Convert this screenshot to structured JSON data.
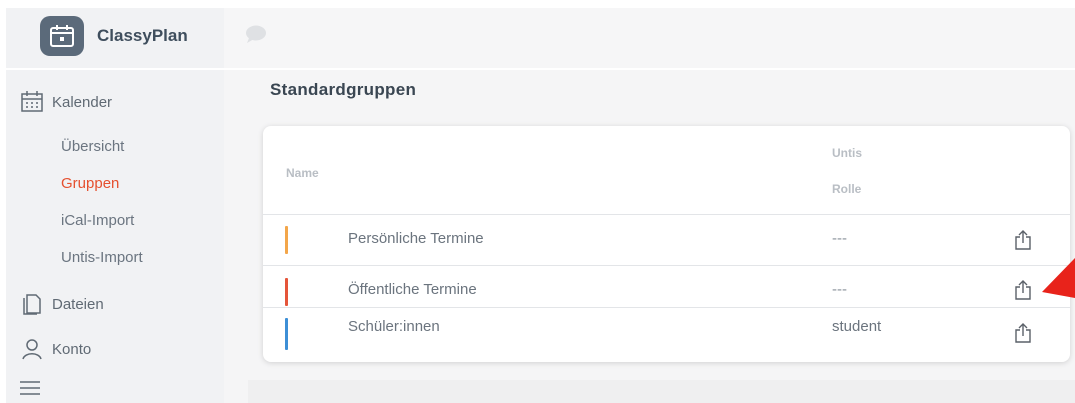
{
  "header": {
    "brand": "ClassyPlan",
    "logo_icon": "calendar-icon",
    "chat_icon": "speech-bubble-icon"
  },
  "sidebar": {
    "calendar_label": "Kalender",
    "sub_items": [
      {
        "label": "Übersicht",
        "active": false
      },
      {
        "label": "Gruppen",
        "active": true
      },
      {
        "label": "iCal-Import",
        "active": false
      },
      {
        "label": "Untis-Import",
        "active": false
      }
    ],
    "files_label": "Dateien",
    "account_label": "Konto",
    "menu_icon": "hamburger-menu-icon"
  },
  "main": {
    "section_title": "Standardgruppen",
    "table": {
      "headers": {
        "name": "Name",
        "role_line1": "Untis",
        "role_line2": "Rolle"
      },
      "rows": [
        {
          "name": "Persönliche Termine",
          "role": "---",
          "color": "#f3a64a"
        },
        {
          "name": "Öffentliche Termine",
          "role": "---",
          "color": "#e5553a"
        },
        {
          "name": "Schüler:innen",
          "role": "student",
          "color": "#3d8fd6"
        }
      ]
    }
  },
  "colors": {
    "accent": "#e5502f",
    "annotation_arrow": "#e8231b"
  }
}
